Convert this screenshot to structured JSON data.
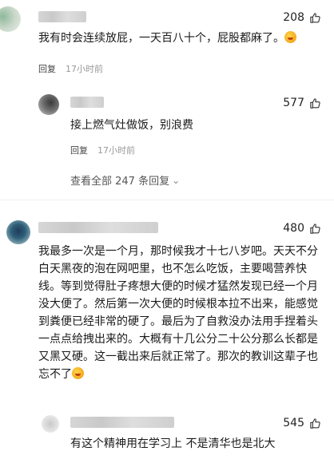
{
  "comments": [
    {
      "likes": "208",
      "text": "我有时会连续放屁，一天百八十个，屁股都麻了。",
      "reply_label": "回复",
      "time": "17小时前",
      "reply": {
        "likes": "577",
        "text": "接上燃气灶做饭，别浪费",
        "reply_label": "回复",
        "time": "17小时前"
      },
      "view_all": "查看全部 247 条回复"
    },
    {
      "likes": "480",
      "text": "我最多一次是一个月，那时候我才十七八岁吧。天天不分白天黑夜的泡在网吧里，也不怎么吃饭，主要喝营养快线。等到觉得肚子疼想大便的时候才猛然发现已经一个月没大便了。然后第一次大便的时候根本拉不出来，能感觉到粪便已经非常的硬了。最后为了自救没办法用手捏着头一点点给拽出来的。大概有十几公分二十公分那么长都是又黑又硬。这一截出来后就正常了。那次的教训这辈子也忘不了",
      "reply": {
        "likes": "545",
        "text": "有这个精神用在学习上 不是清华也是北大"
      }
    }
  ],
  "colors": {
    "text": "#1a1a1a",
    "muted": "#999999",
    "divider": "#eeeeee"
  },
  "icons": {
    "like": "thumbs-up-outline-icon",
    "emoji": "laughing-emoji-icon",
    "chevron": "chevron-down-icon"
  }
}
